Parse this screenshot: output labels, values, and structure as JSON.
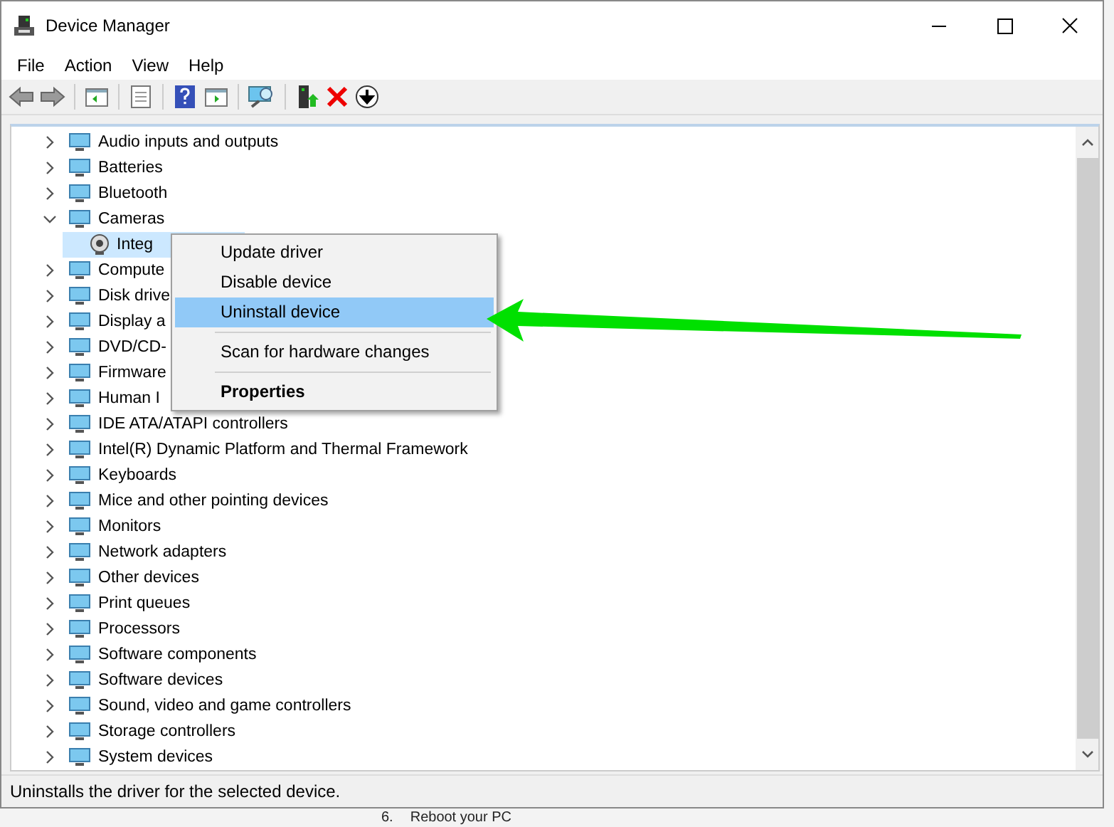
{
  "window": {
    "title": "Device Manager"
  },
  "menu": [
    "File",
    "Action",
    "View",
    "Help"
  ],
  "tree": [
    {
      "label": "Audio inputs and outputs",
      "expanded": false,
      "selected": false
    },
    {
      "label": "Batteries",
      "expanded": false,
      "selected": false
    },
    {
      "label": "Bluetooth",
      "expanded": false,
      "selected": false
    },
    {
      "label": "Cameras",
      "expanded": true,
      "selected": false,
      "children": [
        {
          "label": "Integ",
          "selected": true
        }
      ]
    },
    {
      "label": "Compute",
      "expanded": false,
      "selected": false
    },
    {
      "label": "Disk drive",
      "expanded": false,
      "selected": false
    },
    {
      "label": "Display a",
      "expanded": false,
      "selected": false
    },
    {
      "label": "DVD/CD-",
      "expanded": false,
      "selected": false
    },
    {
      "label": "Firmware",
      "expanded": false,
      "selected": false
    },
    {
      "label": "Human I",
      "expanded": false,
      "selected": false
    },
    {
      "label": "IDE ATA/ATAPI controllers",
      "expanded": false,
      "selected": false
    },
    {
      "label": "Intel(R) Dynamic Platform and Thermal Framework",
      "expanded": false,
      "selected": false
    },
    {
      "label": "Keyboards",
      "expanded": false,
      "selected": false
    },
    {
      "label": "Mice and other pointing devices",
      "expanded": false,
      "selected": false
    },
    {
      "label": "Monitors",
      "expanded": false,
      "selected": false
    },
    {
      "label": "Network adapters",
      "expanded": false,
      "selected": false
    },
    {
      "label": "Other devices",
      "expanded": false,
      "selected": false
    },
    {
      "label": "Print queues",
      "expanded": false,
      "selected": false
    },
    {
      "label": "Processors",
      "expanded": false,
      "selected": false
    },
    {
      "label": "Software components",
      "expanded": false,
      "selected": false
    },
    {
      "label": "Software devices",
      "expanded": false,
      "selected": false
    },
    {
      "label": "Sound, video and game controllers",
      "expanded": false,
      "selected": false
    },
    {
      "label": "Storage controllers",
      "expanded": false,
      "selected": false
    },
    {
      "label": "System devices",
      "expanded": false,
      "selected": false
    }
  ],
  "context_menu": [
    {
      "kind": "item",
      "label": "Update driver",
      "selected": false
    },
    {
      "kind": "item",
      "label": "Disable device",
      "selected": false
    },
    {
      "kind": "item",
      "label": "Uninstall device",
      "selected": true
    },
    {
      "kind": "separator"
    },
    {
      "kind": "item",
      "label": "Scan for hardware changes",
      "selected": false
    },
    {
      "kind": "separator"
    },
    {
      "kind": "bold",
      "label": "Properties",
      "selected": false
    }
  ],
  "status_bar": "Uninstalls the driver for the selected device.",
  "background_text": {
    "number": "6.",
    "text": "Reboot your PC"
  }
}
